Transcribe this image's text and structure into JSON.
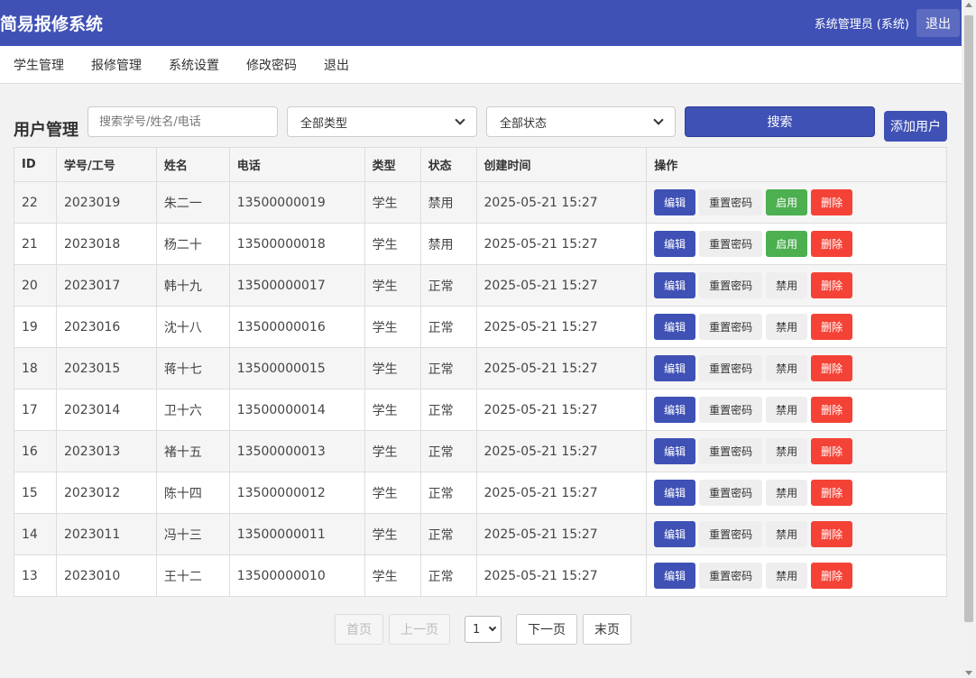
{
  "header": {
    "title": "简易报修系统",
    "user": "系统管理员 (系统)",
    "logout": "退出"
  },
  "nav": [
    "学生管理",
    "报修管理",
    "系统设置",
    "修改密码",
    "退出"
  ],
  "toolbar": {
    "heading": "用户管理",
    "search_placeholder": "搜索学号/姓名/电话",
    "type_select": "全部类型",
    "status_select": "全部状态",
    "search_label": "搜索",
    "add_label": "添加用户"
  },
  "table": {
    "headers": [
      "ID",
      "学号/工号",
      "姓名",
      "电话",
      "类型",
      "状态",
      "创建时间",
      "操作"
    ],
    "rows": [
      {
        "id": "22",
        "no": "2023019",
        "name": "朱二一",
        "phone": "13500000019",
        "type": "学生",
        "status": "禁用",
        "created": "2025-05-21 15:27",
        "toggle": "启用"
      },
      {
        "id": "21",
        "no": "2023018",
        "name": "杨二十",
        "phone": "13500000018",
        "type": "学生",
        "status": "禁用",
        "created": "2025-05-21 15:27",
        "toggle": "启用"
      },
      {
        "id": "20",
        "no": "2023017",
        "name": "韩十九",
        "phone": "13500000017",
        "type": "学生",
        "status": "正常",
        "created": "2025-05-21 15:27",
        "toggle": "禁用"
      },
      {
        "id": "19",
        "no": "2023016",
        "name": "沈十八",
        "phone": "13500000016",
        "type": "学生",
        "status": "正常",
        "created": "2025-05-21 15:27",
        "toggle": "禁用"
      },
      {
        "id": "18",
        "no": "2023015",
        "name": "蒋十七",
        "phone": "13500000015",
        "type": "学生",
        "status": "正常",
        "created": "2025-05-21 15:27",
        "toggle": "禁用"
      },
      {
        "id": "17",
        "no": "2023014",
        "name": "卫十六",
        "phone": "13500000014",
        "type": "学生",
        "status": "正常",
        "created": "2025-05-21 15:27",
        "toggle": "禁用"
      },
      {
        "id": "16",
        "no": "2023013",
        "name": "褚十五",
        "phone": "13500000013",
        "type": "学生",
        "status": "正常",
        "created": "2025-05-21 15:27",
        "toggle": "禁用"
      },
      {
        "id": "15",
        "no": "2023012",
        "name": "陈十四",
        "phone": "13500000012",
        "type": "学生",
        "status": "正常",
        "created": "2025-05-21 15:27",
        "toggle": "禁用"
      },
      {
        "id": "14",
        "no": "2023011",
        "name": "冯十三",
        "phone": "13500000011",
        "type": "学生",
        "status": "正常",
        "created": "2025-05-21 15:27",
        "toggle": "禁用"
      },
      {
        "id": "13",
        "no": "2023010",
        "name": "王十二",
        "phone": "13500000010",
        "type": "学生",
        "status": "正常",
        "created": "2025-05-21 15:27",
        "toggle": "禁用"
      }
    ],
    "actions": {
      "edit": "编辑",
      "reset": "重置密码",
      "delete": "删除"
    }
  },
  "pagination": {
    "first": "首页",
    "prev": "上一页",
    "page": "1",
    "next": "下一页",
    "last": "末页"
  },
  "colors": {
    "primary": "#3f51b5",
    "enable": "#4caf50",
    "delete": "#f44336"
  }
}
